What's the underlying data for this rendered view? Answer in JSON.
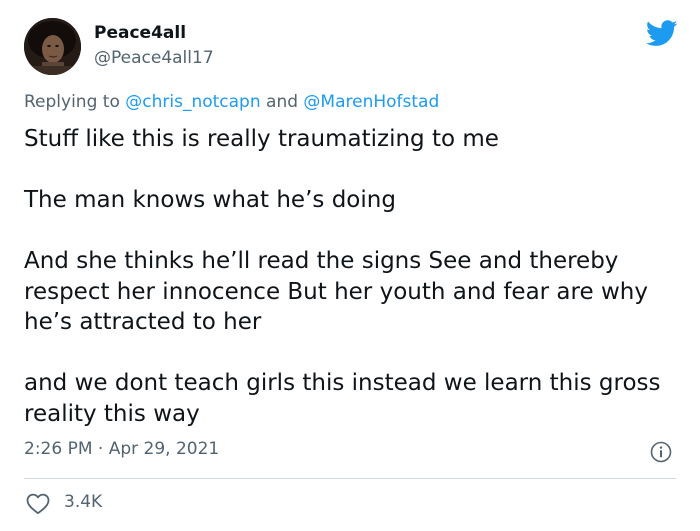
{
  "author": {
    "display_name": "Peace4all",
    "handle": "@Peace4all17"
  },
  "reply": {
    "prefix": "Replying to ",
    "mention_1": "@chris_notcapn",
    "connector": " and ",
    "mention_2": "@MarenHofstad"
  },
  "tweet": {
    "paragraphs": [
      "Stuff like this is really traumatizing to me",
      "The man knows what he’s doing",
      "And she thinks he’ll read the signs See and thereby respect her innocence But her youth and fear are why he’s attracted to her",
      "and we dont teach girls this instead we learn this gross reality this way"
    ],
    "timestamp": "2:26 PM · Apr 29, 2021"
  },
  "engagement": {
    "likes": "3.4K"
  },
  "icons": {
    "brand": "twitter-bird-icon",
    "info": "info-icon",
    "like": "heart-icon"
  },
  "colors": {
    "brand_blue": "#1d9bf0",
    "text_primary": "#0f1419",
    "text_secondary": "#536471",
    "divider": "#cfd9de"
  }
}
